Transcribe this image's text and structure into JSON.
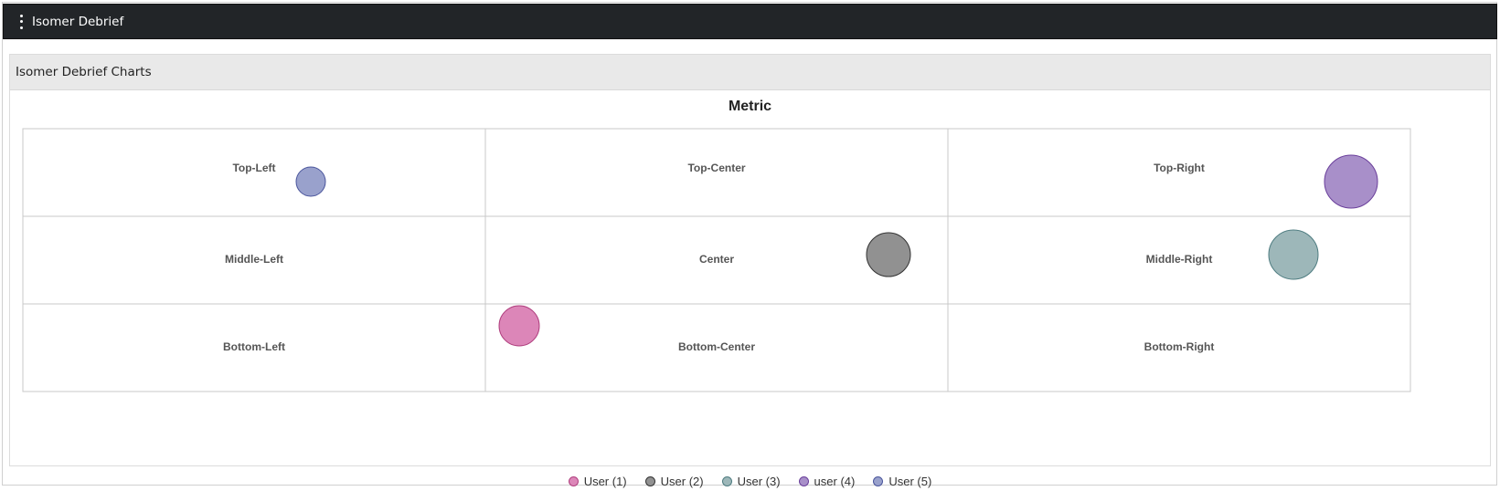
{
  "app": {
    "title": "Isomer Debrief"
  },
  "panel": {
    "title": "Isomer Debrief Charts"
  },
  "chart_data": {
    "type": "scatter",
    "title": "Metric",
    "cells": [
      [
        "Top-Left",
        "Top-Center",
        "Top-Right"
      ],
      [
        "Middle-Left",
        "Center",
        "Middle-Right"
      ],
      [
        "Bottom-Left",
        "Bottom-Center",
        "Bottom-Right"
      ]
    ],
    "series": [
      {
        "name": "User (1)",
        "color": "#dc86b8",
        "stroke": "#b0407f",
        "position": "Bottom-Center",
        "size": 22
      },
      {
        "name": "User (2)",
        "color": "#919191",
        "stroke": "#333333",
        "position": "Center",
        "size": 24
      },
      {
        "name": "User (3)",
        "color": "#9db7b9",
        "stroke": "#4e7c80",
        "position": "Middle-Right",
        "size": 27
      },
      {
        "name": "user (4)",
        "color": "#a88fc9",
        "stroke": "#6a3f9b",
        "position": "Top-Right",
        "size": 29
      },
      {
        "name": "User (5)",
        "color": "#99a1cc",
        "stroke": "#4a559c",
        "position": "Top-Left",
        "size": 16
      }
    ],
    "legend": "bottom"
  }
}
